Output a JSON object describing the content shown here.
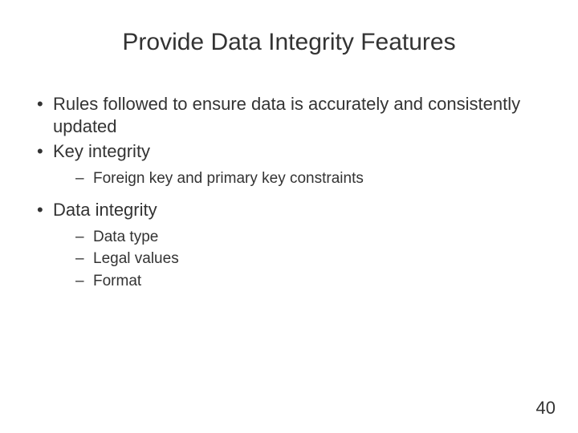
{
  "title": "Provide Data Integrity Features",
  "bullets": {
    "b1": "Rules followed to ensure data is accurately and consistently updated",
    "b2": "Key integrity",
    "b2_sub1": "Foreign key and primary key constraints",
    "b3": "Data integrity",
    "b3_sub1": "Data type",
    "b3_sub2": "Legal values",
    "b3_sub3": "Format"
  },
  "page_number": "40"
}
